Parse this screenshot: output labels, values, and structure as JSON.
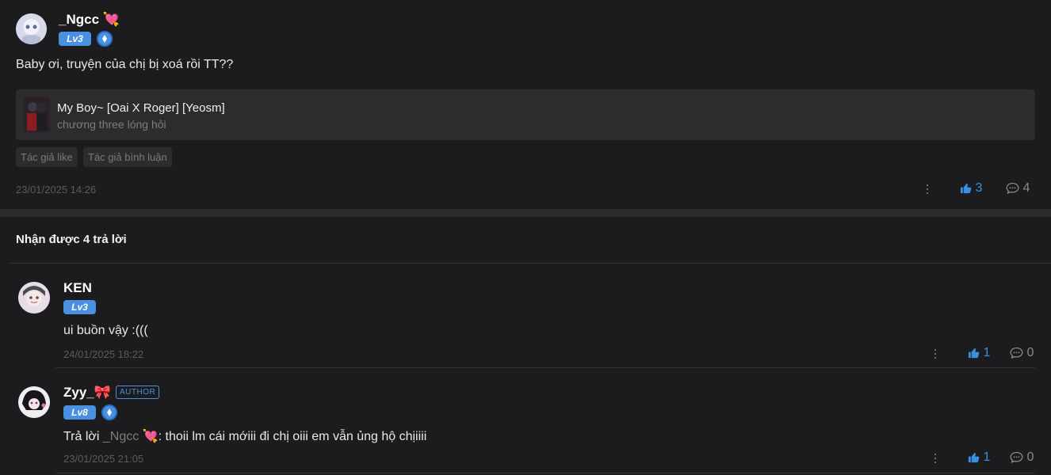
{
  "post": {
    "author": "_Ngcc 💘",
    "level": "Lv3",
    "content": "Baby ơi, truyện của chị bị xoá rồi TT??",
    "story": {
      "title": "My Boy~ [Oai X Roger] [Yeosm]",
      "chapter": "chương three lóng hỏi"
    },
    "tags": [
      "Tác giả like",
      "Tác giả bình luận"
    ],
    "timestamp": "23/01/2025 14:26",
    "likes": "3",
    "comments": "4"
  },
  "replies_header": "Nhận được 4 trả lời",
  "replies": [
    {
      "author": "KEN",
      "level": "Lv3",
      "content": "ui buồn vậy :(((",
      "timestamp": "24/01/2025 18:22",
      "likes": "1",
      "comments": "0"
    },
    {
      "author": "Zyy_🎀",
      "author_badge": "AUTHOR",
      "level": "Lv8",
      "reply_prefix": "Trả lời ",
      "reply_to": "_Ngcc 💘",
      "content": ": thoii lm cái mớiii đi chị oiii em vẫn ủng hộ chịiiii",
      "timestamp": "23/01/2025 21:05",
      "likes": "1",
      "comments": "0"
    }
  ],
  "colors": {
    "accent": "#4a90e2",
    "background": "#1c1c1e",
    "card": "#2c2c2e"
  }
}
